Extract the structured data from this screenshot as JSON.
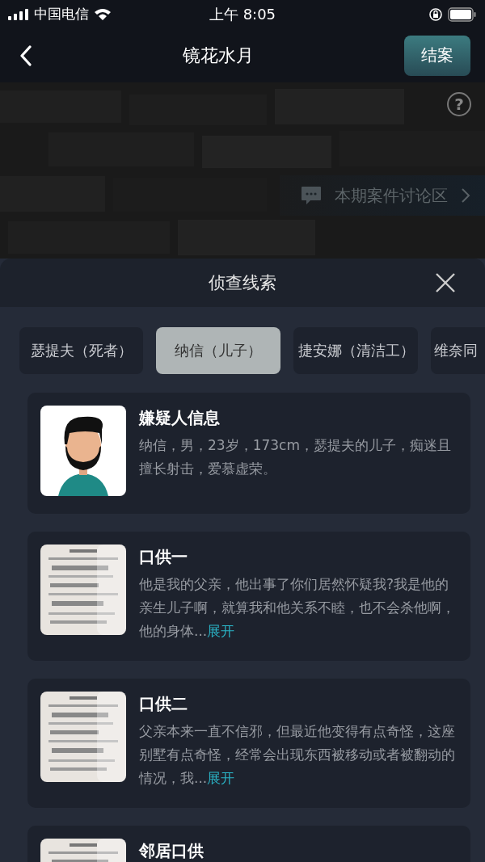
{
  "status_bar": {
    "carrier": "中国电信",
    "time": "上午 8:05"
  },
  "nav": {
    "title": "镜花水月",
    "action": "结案"
  },
  "banner": {
    "kind": "picture",
    "help": "?",
    "discussion": "本期案件讨论区"
  },
  "sheet": {
    "title": "侦查线索",
    "tabs": [
      {
        "label": "瑟提夫（死者）",
        "selected": false
      },
      {
        "label": "纳信（儿子）",
        "selected": true
      },
      {
        "label": "捷安娜（清洁工）",
        "selected": false
      },
      {
        "label": "维奈同",
        "selected": false
      }
    ],
    "cards": [
      {
        "kind": "avatar",
        "title": "嫌疑人信息",
        "text": "纳信，男，23岁，173cm，瑟提夫的儿子，痴迷且擅长射击，爱慕虚荣。"
      },
      {
        "kind": "document",
        "title": "口供一",
        "text": "他是我的父亲，他出事了你们居然怀疑我?我是他的亲生儿子啊，就算我和他关系不睦，也不会杀他啊，他的身体...",
        "more": "展开"
      },
      {
        "kind": "document",
        "title": "口供二",
        "text": "父亲本来一直不信邪，但最近他变得有点奇怪，这座别墅有点奇怪，经常会出现东西被移动或者被翻动的情况，我...",
        "more": "展开"
      },
      {
        "kind": "document",
        "title": "邻居口供"
      }
    ]
  }
}
